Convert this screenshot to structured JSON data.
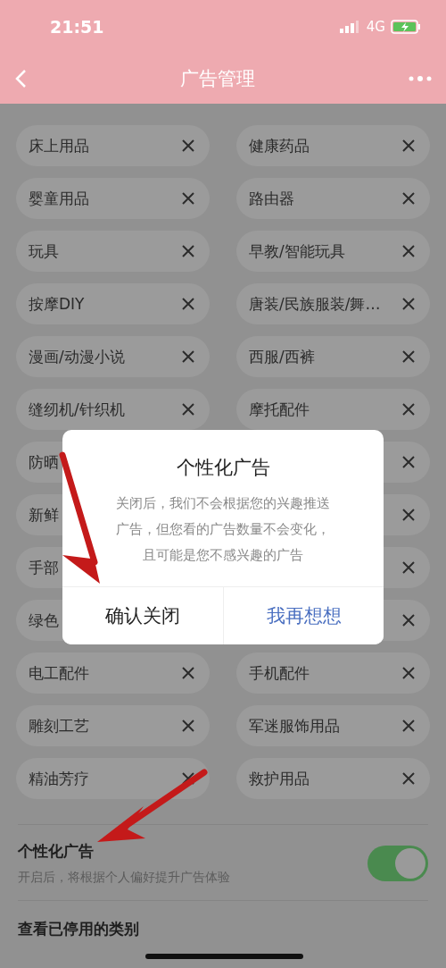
{
  "status_bar": {
    "time": "21:51",
    "network": "4G",
    "charging": true
  },
  "nav": {
    "title": "广告管理"
  },
  "categories": [
    {
      "left": "床上用品",
      "right": "健康药品"
    },
    {
      "left": "婴童用品",
      "right": "路由器"
    },
    {
      "left": "玩具",
      "right": "早教/智能玩具"
    },
    {
      "left": "按摩DIY",
      "right": "唐装/民族服装/舞…"
    },
    {
      "left": "漫画/动漫小说",
      "right": "西服/西裤"
    },
    {
      "left": "缝纫机/针织机",
      "right": "摩托配件"
    },
    {
      "left": "防晒"
    },
    {
      "left": "新鲜"
    },
    {
      "left": "手部"
    },
    {
      "left": "绿色"
    },
    {
      "left": "电工配件",
      "right": "手机配件"
    },
    {
      "left": "雕刻工艺",
      "right": "军迷服饰用品"
    },
    {
      "left": "精油芳疗",
      "right": "救护用品"
    }
  ],
  "settings": [
    {
      "kind": "toggle",
      "title": "个性化广告",
      "description": "开启后，将根据个人偏好提升广告体验",
      "on": true
    },
    {
      "kind": "link",
      "title": "查看已停用的类别"
    }
  ],
  "dialog": {
    "title": "个性化广告",
    "message_lines": [
      "关闭后，我们不会根据您的兴趣推送",
      "广告，但您看的广告数量不会变化，",
      "且可能是您不感兴趣的广告"
    ],
    "buttons": [
      {
        "label": "确认关闭",
        "kind": "confirm"
      },
      {
        "label": "我再想想",
        "kind": "cancel"
      }
    ]
  }
}
